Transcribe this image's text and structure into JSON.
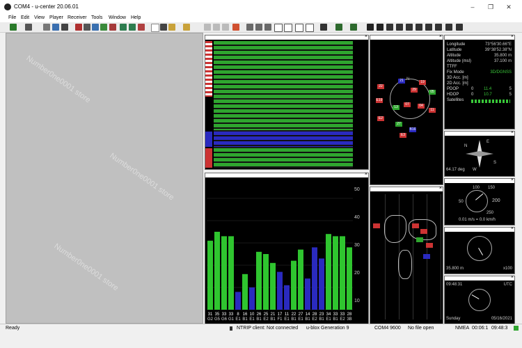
{
  "window": {
    "title": "COM4 - u-center 20.06.01",
    "controls": [
      "–",
      "❐",
      "✕"
    ]
  },
  "menu": [
    "File",
    "Edit",
    "View",
    "Player",
    "Receiver",
    "Tools",
    "Window",
    "Help"
  ],
  "nav_panel": {
    "longitude_label": "Longitude",
    "longitude_value": "73°56'30.66\"E",
    "latitude_label": "Latitude",
    "latitude_value": "39°38'52.38\"N",
    "altitude_label": "Altitude",
    "altitude_value": "35.800 m",
    "altitude_msl_label": "Altitude (msl)",
    "altitude_msl_value": "37.100 m",
    "ttff_label": "TTFF",
    "ttff_value": "",
    "fix_mode_label": "Fix Mode",
    "fix_mode_value": "3D/DGNSS",
    "acc3d_label": "3D Acc. [m]",
    "acc2d_label": "2D Acc. [m]",
    "pdop_label": "PDOP",
    "pdop_values": [
      "0",
      "11.4",
      "5"
    ],
    "hdop_label": "HDOP",
    "hdop_values": [
      "0",
      "10.7",
      "5"
    ],
    "satellites_label": "Satellites"
  },
  "compass": {
    "heading": "64.17 deg",
    "labels": [
      "N",
      "E",
      "S",
      "W"
    ]
  },
  "speedometer": {
    "ticks": [
      "100",
      "150",
      "50",
      "200",
      "250"
    ],
    "readout": "0.01 m/s = 0.0 km/h"
  },
  "altimeter": {
    "readout": "35.800 m",
    "multiplier": "x100"
  },
  "clock": {
    "time": "09:48:31",
    "tz": "UTC",
    "day": "Sunday",
    "date": "05/16/2021"
  },
  "cn0_chart": {
    "y_ticks": [
      "50",
      "40",
      "30",
      "20",
      "10"
    ],
    "bar_labels": [
      "31",
      "35",
      "33",
      "33",
      "8",
      "16",
      "10",
      "26",
      "25",
      "21",
      "17",
      "11",
      "22",
      "27",
      "14",
      "28",
      "23",
      "34",
      "33",
      "33",
      "28"
    ],
    "bar_ids": [
      "G2",
      "G5",
      "G6",
      "G1",
      "E1",
      "B1",
      "E1",
      "B1",
      "E2",
      "B1",
      "F1",
      "E1",
      "B1",
      "E1",
      "B1",
      "E2",
      "B1",
      "E1",
      "B1",
      "E2",
      "3B"
    ]
  },
  "status": {
    "ready": "Ready",
    "ntrip": "NTRIP client: Not connected",
    "generation": "u-blox Generation 9",
    "port": "COM4 9600",
    "file": "No file open",
    "protocol": "NMEA",
    "time1": "00:06:1",
    "time2": "09:48:3"
  },
  "watermark": "Number0ne0001 store"
}
